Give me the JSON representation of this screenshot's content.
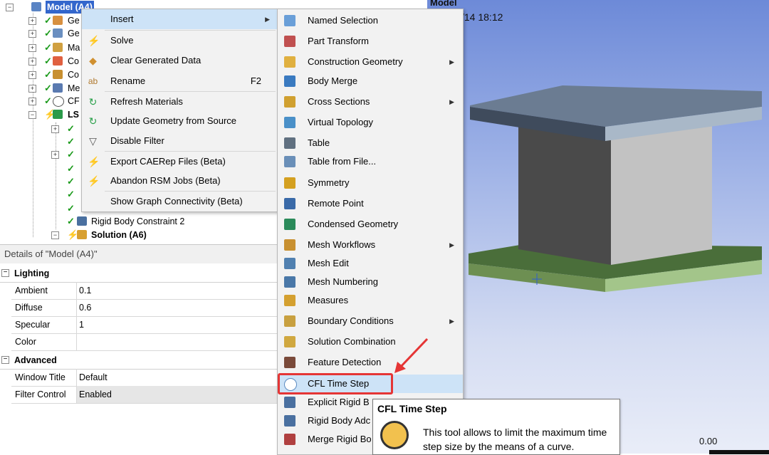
{
  "tree": {
    "root_label": "Model (A4)",
    "items": [
      {
        "label": "Ge"
      },
      {
        "label": "Ge"
      },
      {
        "label": "Ma"
      },
      {
        "label": "Co"
      },
      {
        "label": "Co"
      },
      {
        "label": "Me"
      },
      {
        "label": "CF"
      },
      {
        "label": "LS"
      },
      {
        "label": "Rigid Body Constraint 2"
      },
      {
        "label": "Solution (A6)"
      }
    ]
  },
  "context_menu": {
    "items": [
      {
        "label": "Insert",
        "icon": "none",
        "submenu": true
      },
      {
        "label": "Solve",
        "icon": "lightning-icon"
      },
      {
        "label": "Clear Generated Data",
        "icon": "eraser-icon"
      },
      {
        "label": "Rename",
        "icon": "rename-icon",
        "shortcut": "F2"
      },
      {
        "label": "Refresh Materials",
        "icon": "refresh-icon"
      },
      {
        "label": "Update Geometry from Source",
        "icon": "refresh-icon"
      },
      {
        "label": "Disable Filter",
        "icon": "filter-icon"
      },
      {
        "label": "Export CAERep Files (Beta)",
        "icon": "lightning-icon"
      },
      {
        "label": "Abandon RSM Jobs (Beta)",
        "icon": "lightning-icon"
      },
      {
        "label": "Show Graph Connectivity (Beta)",
        "icon": "none"
      }
    ]
  },
  "submenu": {
    "items": [
      {
        "label": "Named Selection",
        "color": "#6a9fd8"
      },
      {
        "label": "Part Transform",
        "color": "#c05050"
      },
      {
        "label": "Construction Geometry",
        "color": "#e0b040",
        "submenu": true
      },
      {
        "label": "Body Merge",
        "color": "#3a7ac0"
      },
      {
        "label": "Cross Sections",
        "color": "#d0a030",
        "submenu": true
      },
      {
        "label": "Virtual Topology",
        "color": "#4a90c8"
      },
      {
        "label": "Table",
        "color": "#607080"
      },
      {
        "label": "Table from File...",
        "color": "#6a8fb8"
      },
      {
        "label": "Symmetry",
        "color": "#d4a020"
      },
      {
        "label": "Remote Point",
        "color": "#3a6aa8"
      },
      {
        "label": "Condensed Geometry",
        "color": "#2a8a5a"
      },
      {
        "label": "Mesh Workflows",
        "color": "#c89030",
        "submenu": true
      },
      {
        "label": "Mesh Edit",
        "color": "#5080b0"
      },
      {
        "label": "Mesh Numbering",
        "color": "#4a78a8"
      },
      {
        "label": "Measures",
        "color": "#d4a030"
      },
      {
        "label": "Boundary Conditions",
        "color": "#c8a040",
        "submenu": true
      },
      {
        "label": "Solution Combination",
        "color": "#d0a840"
      },
      {
        "label": "Feature Detection",
        "color": "#7a4a3a"
      },
      {
        "label": "CFL Time Step",
        "color": "#5a8ac0",
        "highlight": true
      },
      {
        "label": "Explicit Rigid B",
        "color": "#4a70a0"
      },
      {
        "label": "Rigid Body Adc",
        "color": "#4a70a0"
      },
      {
        "label": "Merge Rigid Bo",
        "color": "#b04040"
      }
    ]
  },
  "details": {
    "title": "Details of \"Model (A4)\"",
    "groups": [
      {
        "name": "Lighting",
        "rows": [
          {
            "key": "Ambient",
            "value": "0.1"
          },
          {
            "key": "Diffuse",
            "value": "0.6"
          },
          {
            "key": "Specular",
            "value": "1"
          },
          {
            "key": "Color",
            "value": ""
          }
        ]
      },
      {
        "name": "Advanced",
        "rows": [
          {
            "key": "Window Title",
            "value": "Default"
          },
          {
            "key": "Filter Control",
            "value": "Enabled"
          }
        ]
      }
    ]
  },
  "viewport": {
    "title": "Model",
    "date": "/14 18:12",
    "scale_label": "0.00"
  },
  "tooltip": {
    "title": "CFL Time Step",
    "text": "This tool allows to limit the maximum time step size by the means of a curve."
  }
}
